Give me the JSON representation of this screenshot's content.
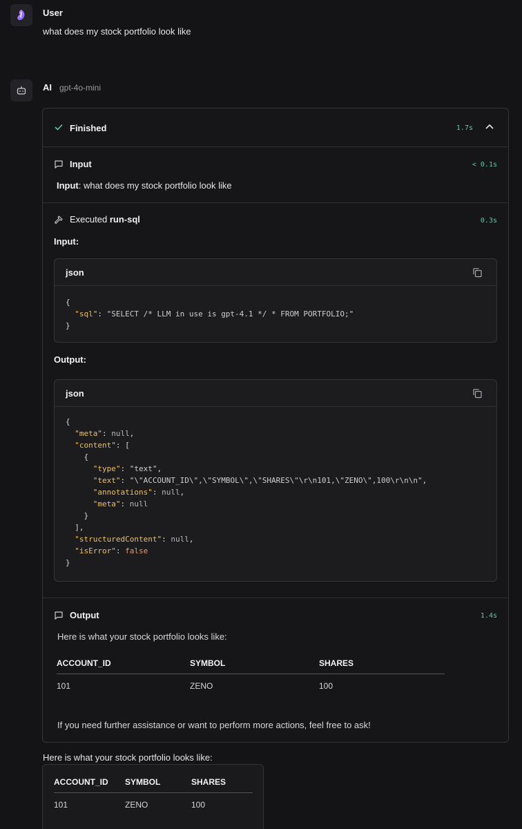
{
  "user_message": {
    "author": "User",
    "text": "what does my stock portfolio look like"
  },
  "ai_message": {
    "author": "AI",
    "model": "gpt-4o-mini"
  },
  "run": {
    "status": "Finished",
    "total_time": "1.7s",
    "input_step": {
      "title": "Input",
      "time": "< 0.1s",
      "label": "Input",
      "text": ": what does my stock portfolio look like"
    },
    "tool_step": {
      "prefix": "Executed",
      "tool_name": "run-sql",
      "time": "0.3s",
      "input_label": "Input:",
      "output_label": "Output:",
      "input_lang": "json",
      "output_lang": "json",
      "input_code": {
        "open": "{",
        "key_sql": "\"sql\"",
        "val_sql": "\"SELECT /* LLM in use is gpt-4.1 */ * FROM PORTFOLIO;\"",
        "close": "}"
      },
      "output_code": {
        "key_meta": "\"meta\"",
        "key_content": "\"content\"",
        "key_type": "\"type\"",
        "val_type": "\"text\"",
        "key_text": "\"text\"",
        "val_text": "\"\\\"ACCOUNT_ID\\\",\\\"SYMBOL\\\",\\\"SHARES\\\"\\r\\n101,\\\"ZENO\\\",100\\r\\n\\n\"",
        "key_annotations": "\"annotations\"",
        "key_meta2": "\"meta\"",
        "key_structured": "\"structuredContent\"",
        "key_iserror": "\"isError\"",
        "null": "null",
        "false": "false"
      }
    },
    "output_step": {
      "title": "Output",
      "time": "1.4s",
      "intro": "Here is what your stock portfolio looks like:",
      "columns": [
        "ACCOUNT_ID",
        "SYMBOL",
        "SHARES"
      ],
      "rows": [
        [
          "101",
          "ZENO",
          "100"
        ]
      ],
      "outro": "If you need further assistance or want to perform more actions, feel free to ask!"
    }
  },
  "final_answer": {
    "intro": "Here is what your stock portfolio looks like:",
    "columns": [
      "ACCOUNT_ID",
      "SYMBOL",
      "SHARES"
    ],
    "rows": [
      [
        "101",
        "ZENO",
        "100"
      ]
    ]
  },
  "colors": {
    "background": "#141416",
    "accent_time": "#5fc9a8",
    "json_key": "#e8c170",
    "json_bool": "#e79a6b"
  }
}
